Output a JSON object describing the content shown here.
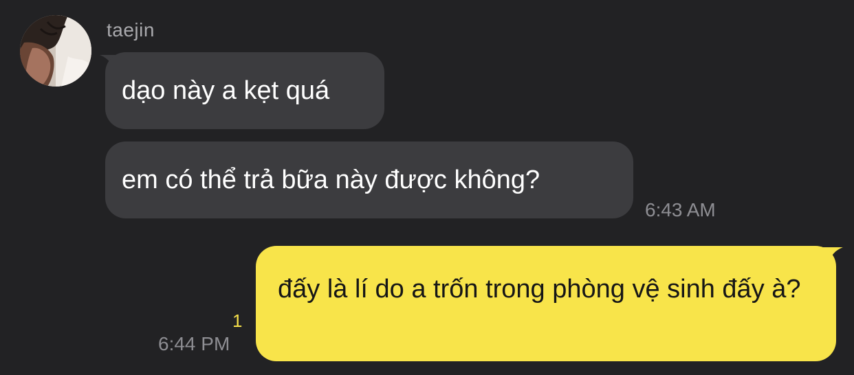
{
  "chat": {
    "sender": {
      "name": "taejin",
      "avatar_icon": "profile-photo"
    },
    "incoming": [
      {
        "text": "dạo này a kẹt quá"
      },
      {
        "text": "em có thể trả bữa này được không?"
      }
    ],
    "incoming_time": "6:43 AM",
    "outgoing": {
      "text": "đấy là lí do a trốn trong phòng vệ sinh đấy à?",
      "time": "6:44 PM",
      "unread_count": "1"
    }
  },
  "colors": {
    "background": "#222224",
    "incoming_bubble": "#3c3c3f",
    "outgoing_bubble": "#f8e44a",
    "timestamp": "#8e8e93",
    "unread_count": "#f6e04a"
  }
}
